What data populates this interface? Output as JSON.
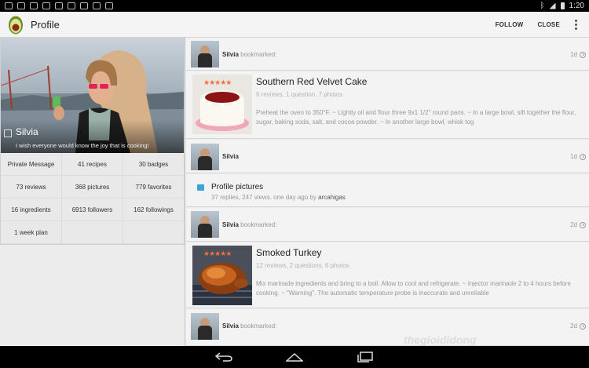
{
  "status_bar": {
    "time": "1:20"
  },
  "action_bar": {
    "title": "Profile",
    "follow_label": "FOLLOW",
    "close_label": "CLOSE"
  },
  "profile": {
    "name": "Silvia",
    "bio": "I wish everyone would know the joy that is cooking!",
    "stats": [
      {
        "label": "Private Message"
      },
      {
        "label": "41 recipes"
      },
      {
        "label": "30 badges"
      },
      {
        "label": "73 reviews"
      },
      {
        "label": "368 pictures"
      },
      {
        "label": "779 favorites"
      },
      {
        "label": "16 ingredients"
      },
      {
        "label": "6913 followers"
      },
      {
        "label": "162 followings"
      },
      {
        "label": "1 week plan"
      }
    ]
  },
  "feed": {
    "item1": {
      "user": "Silvia",
      "action": " bookmarked:",
      "time": "1d"
    },
    "recipe1": {
      "stars": "★★★★★",
      "title": "Southern Red Velvet Cake",
      "meta": "6 reviews, 1 question, 7 photos",
      "desc": "Preheat the oven to 350°F. ~ Lightly oil and flour three 9x1 1/2\" round pans. ~ In a large bowl, sift together the flour, sugar, baking soda, salt, and cocoa powder. ~ In another large bowl, whisk tog"
    },
    "item2": {
      "user": "Silvia",
      "time": "1d"
    },
    "topic": {
      "title": "Profile pictures",
      "meta": "37 replies, 247 views. one day ago by ",
      "author": "arcahigas"
    },
    "item3": {
      "user": "Silvia",
      "action": " bookmarked:",
      "time": "2d"
    },
    "recipe2": {
      "stars": "★★★★★",
      "title": "Smoked Turkey",
      "meta": "12 reviews, 2 questions, 6 photos",
      "desc": "Mix marinade ingredients and bring to a boil. Allow to cool and refrigerate. ~ Injector marinade 2 to 4 hours before cooking. ~ \"Warning\". The automatic temperature probe is inaccurate and unreliable"
    },
    "item4": {
      "user": "Silvia",
      "action": " bookmarked:",
      "time": "2d"
    }
  },
  "watermark": "thegioididong",
  "colors": {
    "accent_star": "#f56e3c",
    "topic_icon": "#3ba3d8"
  }
}
